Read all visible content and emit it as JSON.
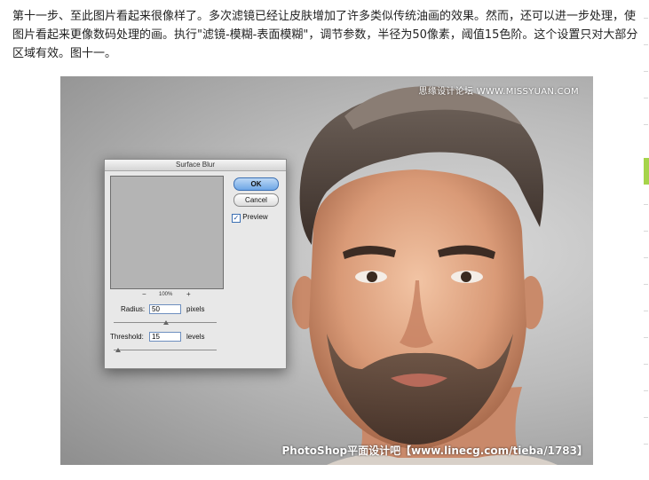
{
  "article": {
    "paragraph": "第十一步、至此图片看起来很像样了。多次滤镜已经让皮肤增加了许多类似传统油画的效果。然而，还可以进一步处理，使图片看起来更像数码处理的画。执行\"滤镜-模糊-表面模糊\"，调节参数，半径为50像素，阈值15色阶。这个设置只对大部分区域有效。图十一。"
  },
  "photo": {
    "watermark_top": "思缘设计论坛 WWW.MISSYUAN.COM",
    "watermark_bottom": "PhotoShop平面设计吧【www.linecg.com/tieba/1783】"
  },
  "dialog": {
    "title": "Surface Blur",
    "ok_label": "OK",
    "cancel_label": "Cancel",
    "preview_label": "Preview",
    "preview_checked": true,
    "zoom_minus": "−",
    "zoom_level": "100%",
    "zoom_plus": "+",
    "radius_label": "Radius:",
    "radius_value": "50",
    "radius_unit": "pixels",
    "threshold_label": "Threshold:",
    "threshold_value": "15",
    "threshold_unit": "levels"
  },
  "colors": {
    "accent_bar": "#a6d44a",
    "ok_button": "#6ea6e6"
  }
}
